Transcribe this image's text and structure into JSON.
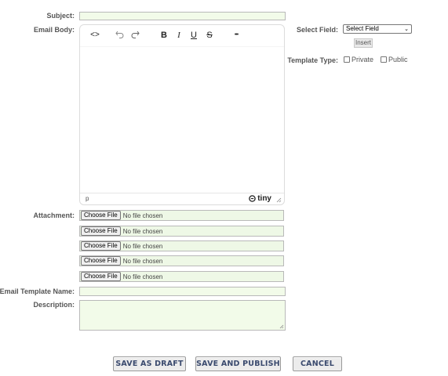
{
  "labels": {
    "subject": "Subject:",
    "email_body": "Email Body:",
    "attachment": "Attachment:",
    "template_name": "Email Template Name:",
    "description": "Description:",
    "select_field": "Select Field:",
    "template_type": "Template Type:"
  },
  "editor": {
    "toolbar": {
      "source_code": "<>",
      "bold": "B",
      "italic": "I",
      "underline": "U",
      "strikethrough": "S",
      "more": "•••"
    },
    "status_path": "p",
    "brand": "tiny"
  },
  "attachments": [
    {
      "button": "Choose File",
      "status": "No file chosen"
    },
    {
      "button": "Choose File",
      "status": "No file chosen"
    },
    {
      "button": "Choose File",
      "status": "No file chosen"
    },
    {
      "button": "Choose File",
      "status": "No file chosen"
    },
    {
      "button": "Choose File",
      "status": "No file chosen"
    }
  ],
  "select_field": {
    "selected": "Select Field"
  },
  "insert_button": "Insert",
  "template_type": {
    "private": "Private",
    "public": "Public"
  },
  "actions": {
    "save_draft": "SAVE AS DRAFT",
    "save_publish": "SAVE AND PUBLISH",
    "cancel": "CANCEL"
  }
}
